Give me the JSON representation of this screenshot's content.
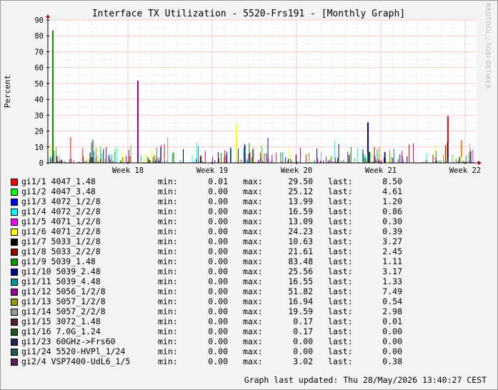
{
  "chart_data": {
    "type": "bar",
    "title": "Interface TX Utilization - 5520-Frs191 - [Monthly Graph]",
    "ylabel": "Percent",
    "ylim": [
      0,
      90
    ],
    "yticks": [
      0,
      10,
      20,
      30,
      40,
      50,
      60,
      70,
      80,
      90
    ],
    "xticks": [
      "Week 18",
      "Week 19",
      "Week 20",
      "Week 21",
      "Week 22"
    ],
    "grid": true,
    "legend_placement": "bottom",
    "series": [
      {
        "name": "gi1/1 4047_1.48",
        "color": "#ff0000",
        "min": "0.01",
        "max": "29.50",
        "last": "8.50"
      },
      {
        "name": "gi1/2 4047_3.48",
        "color": "#00ff00",
        "min": "0.00",
        "max": "25.12",
        "last": "4.61"
      },
      {
        "name": "gi1/3 4072_1/2/8",
        "color": "#0000ff",
        "min": "0.00",
        "max": "13.99",
        "last": "1.20"
      },
      {
        "name": "gi1/4 4072_2/2/8",
        "color": "#00ffff",
        "min": "0.00",
        "max": "16.59",
        "last": "0.86"
      },
      {
        "name": "gi1/5 4071_1/2/8",
        "color": "#ff00ff",
        "min": "0.00",
        "max": "13.09",
        "last": "0.30"
      },
      {
        "name": "gi1/6 4071_2/2/8",
        "color": "#ffff00",
        "min": "0.00",
        "max": "24.23",
        "last": "0.39"
      },
      {
        "name": "gi1/7 5033_1/2/8",
        "color": "#000000",
        "min": "0.00",
        "max": "10.63",
        "last": "3.27"
      },
      {
        "name": "gi1/8 5033_2/2/8",
        "color": "#990000",
        "min": "0.00",
        "max": "21.61",
        "last": "2.45"
      },
      {
        "name": "gi1/9 5039_1.48",
        "color": "#009900",
        "min": "0.00",
        "max": "83.48",
        "last": "1.11"
      },
      {
        "name": "gi1/10 5039_2.48",
        "color": "#000099",
        "min": "0.00",
        "max": "25.56",
        "last": "3.17"
      },
      {
        "name": "gi1/11 5039_4.48",
        "color": "#009999",
        "min": "0.00",
        "max": "16.55",
        "last": "1.33"
      },
      {
        "name": "gi1/12 5056_1/2/8",
        "color": "#990099",
        "min": "0.00",
        "max": "51.82",
        "last": "7.49"
      },
      {
        "name": "gi1/13 5057_1/2/8",
        "color": "#999900",
        "min": "0.00",
        "max": "16.94",
        "last": "0.54"
      },
      {
        "name": "gi1/14 5057_2/2/8",
        "color": "#999999",
        "min": "0.00",
        "max": "19.59",
        "last": "2.98"
      },
      {
        "name": "gi1/15 3072_1.48",
        "color": "#552222",
        "min": "0.00",
        "max": "0.17",
        "last": "0.01"
      },
      {
        "name": "gi1/16 7.0G_1.24",
        "color": "#225522",
        "min": "0.00",
        "max": "0.17",
        "last": "0.00"
      },
      {
        "name": "gi1/23 60GHz->Frs60",
        "color": "#222255",
        "min": "0.00",
        "max": "0.00",
        "last": "0.00"
      },
      {
        "name": "gi1/24 5520-HVPl_1/24",
        "color": "#225555",
        "min": "0.00",
        "max": "0.00",
        "last": "0.00"
      },
      {
        "name": "gi2/4 VSP7400-UdL6_1/5",
        "color": "#552255",
        "min": "0.00",
        "max": "3.02",
        "last": "0.38"
      }
    ]
  },
  "legend_labels": {
    "min": "min:",
    "max": "max:",
    "last": "last:"
  },
  "footer": "Graph last updated: Thu 28/May/2026 13:40:27 CEST",
  "watermark": "RRDTOOL / TOBI OETIKER"
}
